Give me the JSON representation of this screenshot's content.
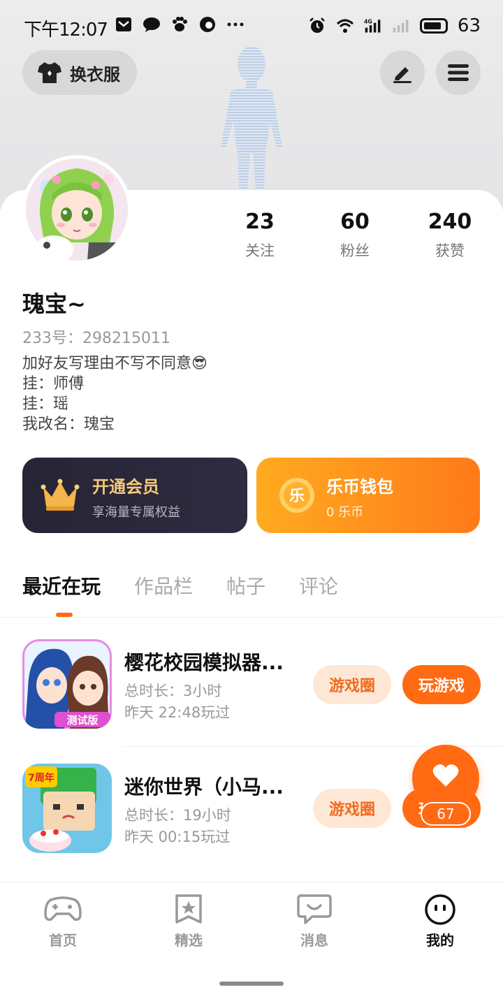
{
  "status_bar": {
    "time": "下午12:07",
    "network": "4G",
    "battery": "63"
  },
  "header": {
    "wardrobe_label": "换衣服",
    "edit_icon": "pencil-icon",
    "menu_icon": "hamburger-icon"
  },
  "profile": {
    "stats": [
      {
        "value": "23",
        "label": "关注"
      },
      {
        "value": "60",
        "label": "粉丝"
      },
      {
        "value": "240",
        "label": "获赞"
      }
    ],
    "username": "瑰宝~",
    "account_id": "233号：298215011",
    "bio": [
      "加好友写理由不写不同意😎",
      "挂：师傅",
      "挂：瑶",
      "我改名：瑰宝"
    ]
  },
  "promos": {
    "vip": {
      "title": "开通会员",
      "subtitle": "享海量专属权益"
    },
    "wallet": {
      "title": "乐币钱包",
      "subtitle": "0 乐币",
      "coin_glyph": "乐"
    }
  },
  "tabs": [
    "最近在玩",
    "作品栏",
    "帖子",
    "评论"
  ],
  "games": [
    {
      "title": "樱花校园模拟器...",
      "duration": "总时长：3小时",
      "last_played": "昨天  22:48玩过",
      "badge": "测试版",
      "circle_label": "游戏圈",
      "play_label": "玩游戏"
    },
    {
      "title": "迷你世界（小马...",
      "duration": "总时长：19小时",
      "last_played": "昨天  00:15玩过",
      "badge": "7周年",
      "circle_label": "游戏圈",
      "play_label": "玩游戏"
    }
  ],
  "floating_like": {
    "count": "67"
  },
  "bottom_nav": [
    {
      "label": "首页",
      "icon": "gamepad-icon"
    },
    {
      "label": "精选",
      "icon": "star-bookmark-icon"
    },
    {
      "label": "消息",
      "icon": "chat-bubble-icon"
    },
    {
      "label": "我的",
      "icon": "face-icon"
    }
  ],
  "colors": {
    "accent": "#ff6a13",
    "vip_bg": "#262435",
    "vip_text": "#f6c87a",
    "wallet_bg": "#ff9a1a"
  }
}
